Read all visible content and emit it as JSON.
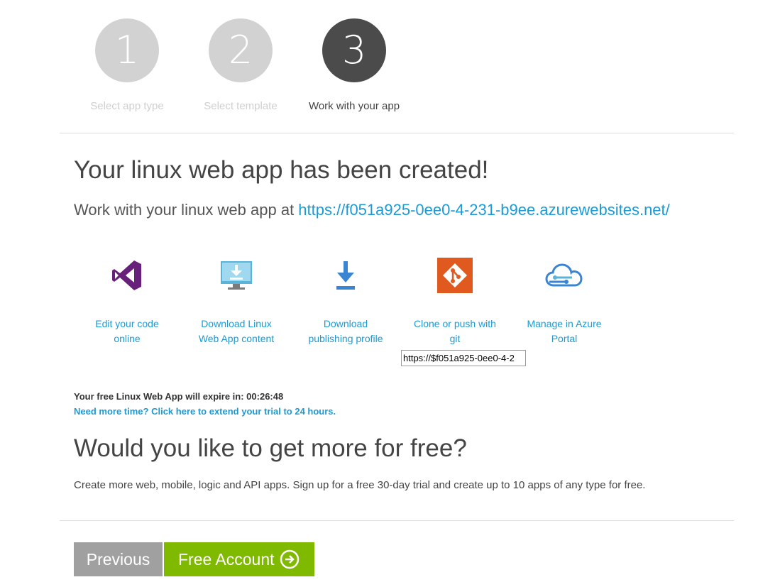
{
  "steps": [
    {
      "number": "1",
      "label": "Select app type",
      "active": false
    },
    {
      "number": "2",
      "label": "Select template",
      "active": false
    },
    {
      "number": "3",
      "label": "Work with your app",
      "active": true
    }
  ],
  "main": {
    "title": "Your linux web app has been created!",
    "subtitle_prefix": "Work with your linux web app at ",
    "app_url": "https://f051a925-0ee0-4-231-b9ee.azurewebsites.net/"
  },
  "tools": [
    {
      "label": "Edit your code online",
      "icon": "visual-studio-icon"
    },
    {
      "label": "Download Linux Web App content",
      "icon": "download-monitor-icon"
    },
    {
      "label": "Download publishing profile",
      "icon": "download-icon"
    },
    {
      "label": "Clone or push with git",
      "icon": "git-icon"
    },
    {
      "label": "Manage in Azure Portal",
      "icon": "azure-cloud-icon"
    }
  ],
  "git_clone_url": "https://$f051a925-0ee0-4-2",
  "trial": {
    "expire_text": "Your free Linux Web App will expire in: 00:26:48",
    "extend_link": "Need more time? Click here to extend your trial to 24 hours."
  },
  "promo": {
    "heading": "Would you like to get more for free?",
    "description": "Create more web, mobile, logic and API apps. Sign up for a free 30-day trial and create up to 10 apps of any type for free."
  },
  "buttons": {
    "previous": "Previous",
    "free_account": "Free Account"
  },
  "colors": {
    "link": "#1b9ad6",
    "step_active": "#4b4b4b",
    "step_inactive": "#d2d2d2",
    "free_button": "#7fba00",
    "previous_button": "#a0a0a0",
    "visual_studio": "#68217a",
    "git": "#e05a1f"
  }
}
